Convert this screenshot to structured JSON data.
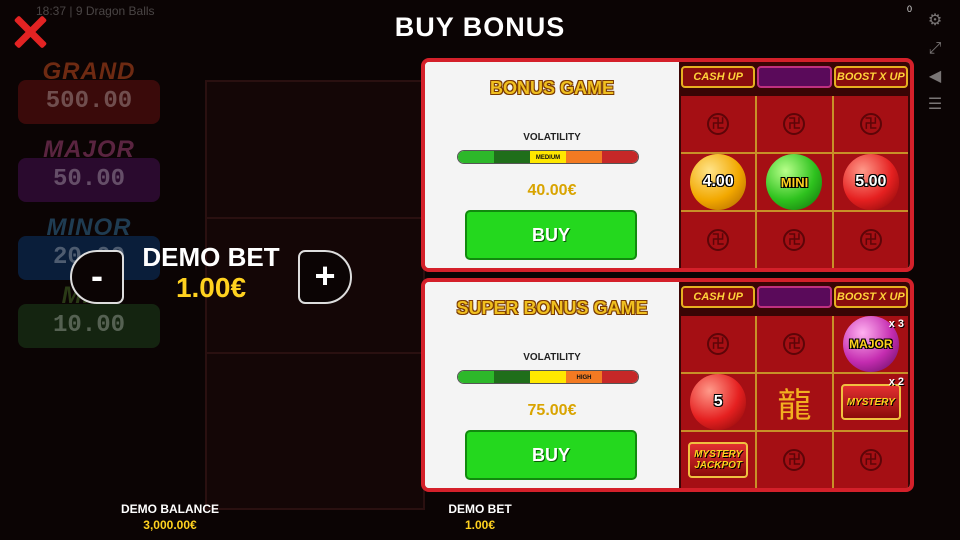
{
  "header": {
    "title": "BUY BONUS",
    "game_info": "18:37 | 9 Dragon Balls",
    "counter": "0"
  },
  "background": {
    "jackpots": [
      {
        "name": "GRAND",
        "value": "500.00"
      },
      {
        "name": "MAJOR",
        "value": "50.00"
      },
      {
        "name": "MINOR",
        "value": "20.00"
      },
      {
        "name": "MINI",
        "value": "10.00"
      }
    ]
  },
  "bet_control": {
    "label": "DEMO BET",
    "value": "1.00€",
    "minus": "-",
    "plus": "+"
  },
  "panels": [
    {
      "title": "BONUS GAME",
      "volatility_label": "VOLATILITY",
      "volatility_level": "MEDIUM",
      "price": "40.00€",
      "buy_label": "BUY",
      "strip": {
        "left": "CASH UP",
        "right": "BOOST X UP"
      },
      "orbs": [
        "4.00",
        "MINI",
        "5.00"
      ]
    },
    {
      "title": "SUPER BONUS GAME",
      "volatility_label": "VOLATILITY",
      "volatility_level": "HIGH",
      "price": "75.00€",
      "buy_label": "BUY",
      "strip": {
        "left": "CASH UP",
        "right": "BOOST X UP"
      },
      "symbols": {
        "major": "MAJOR",
        "major_mult": "x 3",
        "orb": "5",
        "mystery": "MYSTERY",
        "mystery_mult": "x 2",
        "jackpot": "MYSTERY JACKPOT"
      }
    }
  ],
  "footer": {
    "balance_label": "DEMO BALANCE",
    "balance_value": "3,000.00€",
    "bet_label": "DEMO BET",
    "bet_value": "1.00€"
  },
  "colors": {
    "accent_red": "#d4202a",
    "buy_green": "#24d81e",
    "gold": "#ffd21f"
  }
}
